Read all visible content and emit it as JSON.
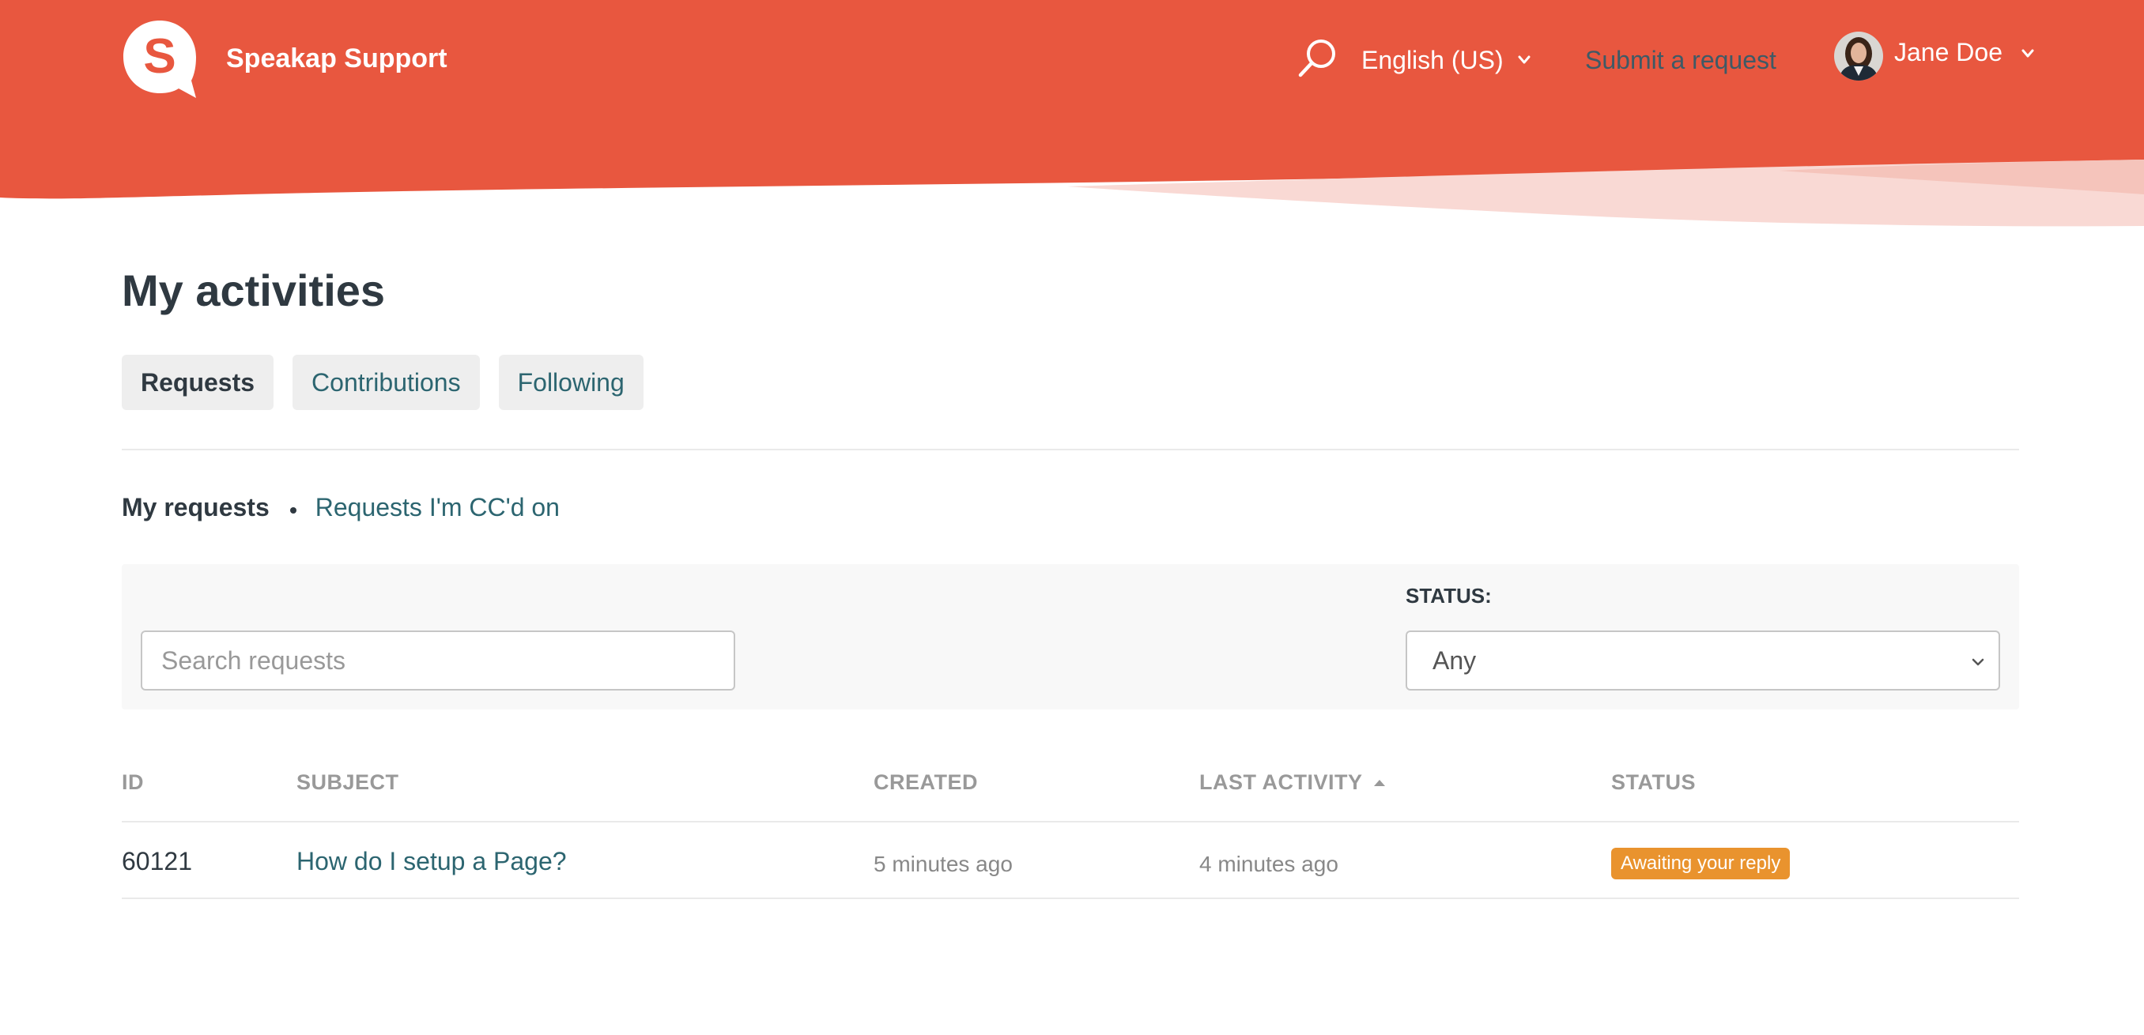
{
  "header": {
    "brand_name": "Speakap Support",
    "logo_letter": "S",
    "search_icon": "search-icon",
    "language_label": "English (US)",
    "submit_request_label": "Submit a request",
    "user_name": "Jane Doe",
    "colors": {
      "brand": "#E8573F",
      "wave_light": "#F9D9D4",
      "wave_mid": "#F5C4BB"
    }
  },
  "page": {
    "title": "My activities",
    "tabs": [
      {
        "label": "Requests",
        "active": true
      },
      {
        "label": "Contributions",
        "active": false
      },
      {
        "label": "Following",
        "active": false
      }
    ],
    "subnav": {
      "current": "My requests",
      "other": "Requests I'm CC'd on"
    }
  },
  "filters": {
    "search_placeholder": "Search requests",
    "status_label": "STATUS:",
    "status_value": "Any"
  },
  "table": {
    "columns": [
      "ID",
      "SUBJECT",
      "CREATED",
      "LAST ACTIVITY",
      "STATUS"
    ],
    "sorted_column": "LAST ACTIVITY",
    "rows": [
      {
        "id": "60121",
        "subject": "How do I setup a Page?",
        "created": "5 minutes ago",
        "last_activity": "4 minutes ago",
        "status": "Awaiting your reply",
        "status_color": "#E9932E"
      }
    ]
  }
}
